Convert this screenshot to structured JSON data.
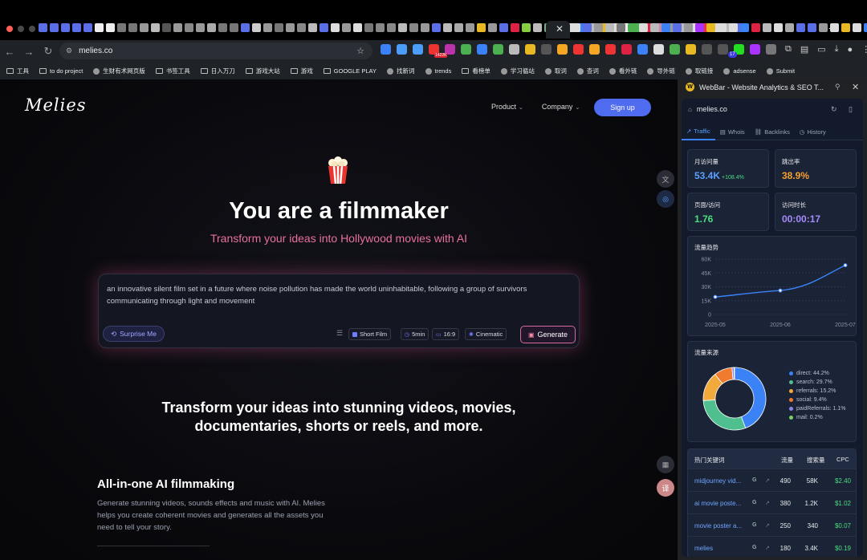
{
  "browser": {
    "url": "melies.co",
    "bookmarks": [
      "工具",
      "to do project",
      "生财有术网页版",
      "书签工具",
      "日入万刀",
      "游戏大站",
      "游戏",
      "GOOGLE PLAY",
      "找新词",
      "trends",
      "看榜单",
      "学习循站",
      "取词",
      "查词",
      "看外链",
      "导外链",
      "取链接",
      "adsense",
      "Submit"
    ],
    "ext_badge": "1422K",
    "ext_badge2": "17",
    "tab_colors": [
      "#5a6ee8",
      "#5a6ee8",
      "#5a6ee8",
      "#5a6ee8",
      "#5a6ee8",
      "#eee",
      "#eee",
      "#777",
      "#777",
      "#999",
      "#bbb",
      "#555",
      "#999",
      "#888",
      "#999",
      "#aaa",
      "#777",
      "#777",
      "#5a6ee8",
      "#ccc",
      "#999",
      "#777",
      "#999",
      "#888",
      "#bbb",
      "#5a6ee8",
      "#ddd",
      "#999",
      "#ddd",
      "#777",
      "#888",
      "#888",
      "#bbb",
      "#888",
      "#999",
      "#5a6ee8",
      "#bbb",
      "#aaa",
      "#999",
      "#e8b923",
      "#999",
      "#5a6ee8",
      "#d24",
      "#8c4",
      "#bbb",
      "#7a8",
      "#555",
      "#ddd",
      "#3b82f6",
      "#bbb",
      "#e8b923",
      "#ddd",
      "#eee",
      "#4caf50",
      "#d24",
      "#c8a",
      "#999",
      "#bbb",
      "#ddd",
      "#e33",
      "#ddd",
      "#bbb",
      "#5a6ee8"
    ],
    "tab_colors2": [
      "#ddd",
      "#5a6ee8",
      "#999",
      "#bbb",
      "#777",
      "#4caf50",
      "#ddd",
      "#bbb",
      "#3b82f6",
      "#5a6ee8",
      "#999",
      "#a3f",
      "#e8b923",
      "#ddd",
      "#ddd",
      "#3b82f6",
      "#d24",
      "#bbb",
      "#ddd",
      "#aaa",
      "#5a6ee8",
      "#5a6ee8",
      "#999",
      "#ddd",
      "#e8b923",
      "#ddd",
      "#3b82f6",
      "#5a6ee8",
      "#e8b923"
    ],
    "ext_colors": [
      "#3b82f6",
      "#4a9df8",
      "#4a9df8",
      "#e33",
      "#b3a",
      "#4caf50",
      "#3b82f6",
      "#4caf50",
      "#bbb",
      "#e8b923",
      "#555",
      "#f5a623",
      "#e33",
      "#f5a623",
      "#e33",
      "#d24",
      "#3b82f6",
      "#ddd",
      "#4caf50",
      "#e8b923",
      "#555",
      "#555",
      "#2d2",
      "#a3f",
      "#777"
    ]
  },
  "page": {
    "logo": "Melies",
    "nav": {
      "product": "Product",
      "company": "Company",
      "signup": "Sign up"
    },
    "hero_title": "You are a filmmaker",
    "hero_subtitle": "Transform your ideas into Hollywood movies with AI",
    "prompt_text": "an innovative silent film set in a future where noise pollution has made the world uninhabitable, following a group of survivors communicating through light and movement",
    "surprise": "Surprise Me",
    "chips": {
      "format": "Short Film",
      "duration": "5min",
      "ratio": "16:9",
      "style": "Cinematic"
    },
    "generate": "Generate",
    "section_title": "Transform your ideas into stunning videos, movies, documentaries, shorts or reels, and more.",
    "feature_title": "All-in-one AI filmmaking",
    "feature_text": "Generate stunning videos, sounds effects and music with AI. Melies helps you create coherent movies and generates all the assets you need to tell your story."
  },
  "sidebar": {
    "title": "WebBar - Website Analytics & SEO T...",
    "domain": "melies.co",
    "tabs": [
      "Traffic",
      "Whois",
      "Backlinks",
      "History"
    ],
    "stats": {
      "visits_label": "月访问量",
      "visits": "53.4K",
      "visits_change": "+108.4%",
      "bounce_label": "跳出率",
      "bounce": "38.9%",
      "pages_label": "页面/访问",
      "pages": "1.76",
      "duration_label": "访问时长",
      "duration": "00:00:17"
    },
    "trend_title": "流量趋势",
    "sources_title": "流量来源",
    "keywords": {
      "headers": {
        "kw": "热门关键词",
        "traffic": "流量",
        "volume": "搜索量",
        "cpc": "CPC"
      },
      "rows": [
        {
          "kw": "midjourney vid...",
          "traffic": "490",
          "volume": "58K",
          "cpc": "$2.40"
        },
        {
          "kw": "ai movie poste...",
          "traffic": "380",
          "volume": "1.2K",
          "cpc": "$1.02"
        },
        {
          "kw": "movie poster a...",
          "traffic": "250",
          "volume": "340",
          "cpc": "$0.07"
        },
        {
          "kw": "melies",
          "traffic": "180",
          "volume": "3.4K",
          "cpc": "$0.19"
        }
      ]
    }
  },
  "chart_data": [
    {
      "type": "line",
      "title": "流量趋势",
      "x": [
        "2025-05",
        "2025-06",
        "2025-07"
      ],
      "series": [
        {
          "values": [
            19000,
            26000,
            53400
          ]
        }
      ],
      "yticks": [
        "60K",
        "45K",
        "30K",
        "15K",
        "0"
      ],
      "ylim": [
        0,
        60000
      ],
      "grid": true,
      "color": "#3b82f6"
    },
    {
      "type": "pie",
      "title": "流量来源",
      "labels": [
        "direct: 44.2%",
        "search: 29.7%",
        "referrals: 15.2%",
        "social: 9.4%",
        "paidReferrals: 1.1%",
        "mail: 0.2%"
      ],
      "values": [
        44.2,
        29.7,
        15.2,
        9.4,
        1.1,
        0.2
      ],
      "colors": [
        "#3b82f6",
        "#4fbf8f",
        "#f2a93b",
        "#f07a2e",
        "#8b85e8",
        "#7ccf6a"
      ],
      "legend": "right"
    }
  ]
}
